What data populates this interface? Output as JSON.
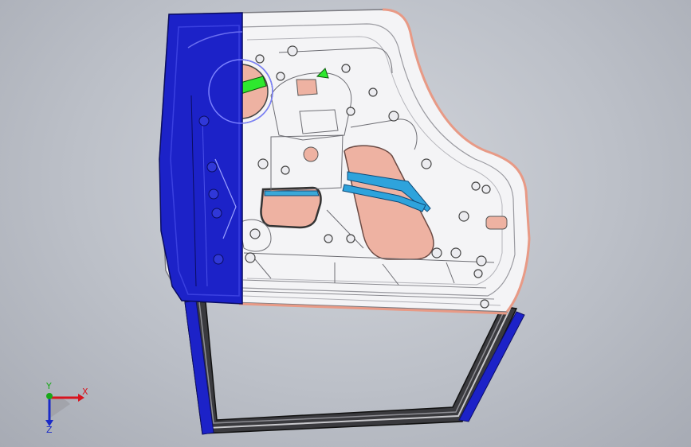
{
  "viewport": {
    "background": "#c4c7cd",
    "model_colors": {
      "blue_region": "#1c22c8",
      "shell": "#f4f4f6",
      "salmon_panel": "#eeb2a2",
      "green_part": "#2ee82e",
      "cyan_bar": "#2ea3dc",
      "frame_dark": "#2a2a2a"
    }
  },
  "triad": {
    "x_label": "X",
    "y_label": "Y",
    "z_label": "Z",
    "x_color": "#d8141e",
    "y_color": "#18a818",
    "z_color": "#1a2ac8",
    "icon": "coordinate-triad-icon"
  }
}
